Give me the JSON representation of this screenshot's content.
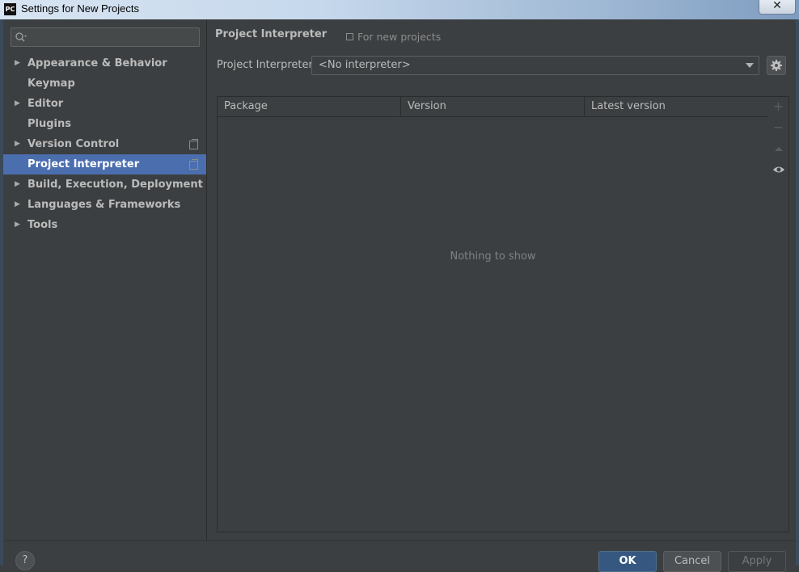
{
  "window": {
    "title": "Settings for New Projects",
    "app_icon": "PC",
    "close_label": "✕"
  },
  "sidebar": {
    "search": {
      "value": "",
      "placeholder": ""
    },
    "items": [
      {
        "label": "Appearance & Behavior",
        "expandable": true
      },
      {
        "label": "Keymap",
        "expandable": false
      },
      {
        "label": "Editor",
        "expandable": true
      },
      {
        "label": "Plugins",
        "expandable": false
      },
      {
        "label": "Version Control",
        "expandable": true,
        "scope_icon": true
      },
      {
        "label": "Project Interpreter",
        "expandable": false,
        "scope_icon": true,
        "selected": true
      },
      {
        "label": "Build, Execution, Deployment",
        "expandable": true
      },
      {
        "label": "Languages & Frameworks",
        "expandable": true
      },
      {
        "label": "Tools",
        "expandable": true
      }
    ]
  },
  "main": {
    "title": "Project Interpreter",
    "scope_note": "For new projects",
    "interpreter_label": "Project Interpreter:",
    "interpreter_value": "<No interpreter>",
    "table": {
      "columns": [
        "Package",
        "Version",
        "Latest version"
      ],
      "rows": [],
      "empty_text": "Nothing to show"
    },
    "tools": [
      "plus-icon",
      "minus-icon",
      "up-arrow-icon",
      "eye-icon"
    ]
  },
  "footer": {
    "help_label": "?",
    "ok_label": "OK",
    "cancel_label": "Cancel",
    "apply_label": "Apply"
  },
  "colors": {
    "background": "#3c3f41",
    "selection": "#4b6eaf",
    "ok_button": "#365880"
  }
}
